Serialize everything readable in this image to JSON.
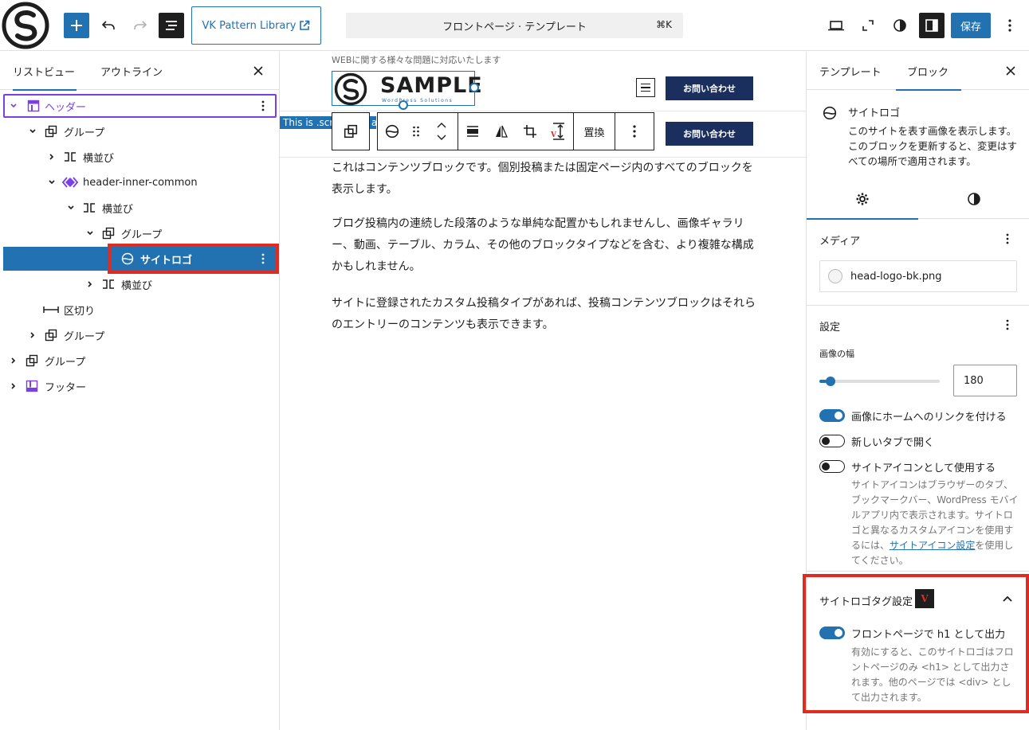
{
  "topbar": {
    "vk_pattern_label": "VK Pattern Library",
    "command_title": "フロントページ · テンプレート",
    "command_shortcut": "⌘K",
    "save_label": "保存"
  },
  "left_panel": {
    "tabs": [
      "リストビュー",
      "アウトライン"
    ],
    "tree": [
      {
        "label": "ヘッダー"
      },
      {
        "label": "グループ"
      },
      {
        "label": "横並び"
      },
      {
        "label": "header-inner-common"
      },
      {
        "label": "横並び"
      },
      {
        "label": "グループ"
      },
      {
        "label": "サイトロゴ"
      },
      {
        "label": "横並び"
      },
      {
        "label": "区切り"
      },
      {
        "label": "グループ"
      },
      {
        "label": "グループ"
      },
      {
        "label": "フッター"
      }
    ]
  },
  "canvas": {
    "tagline": "WEBに関する様々な問題に対応いたします",
    "logo_text": "SAMPLE",
    "logo_sub": "WordPress Solutions",
    "contact_label": "お問い合わせ",
    "screen_reader_text": "This is .scr",
    "screen_reader_tail": "a",
    "replace_label": "置換",
    "paragraphs": [
      "これはコンテンツブロックです。個別投稿または固定ページ内のすべてのブロックを表示します。",
      "ブログ投稿内の連続した段落のような単純な配置かもしれませんし、画像ギャラリー、動画、テーブル、カラム、その他のブロックタイプなどを含む、より複雑な構成かもしれません。",
      "サイトに登録されたカスタム投稿タイプがあれば、投稿コンテンツブロックはそれらのエントリーのコンテンツも表示できます。"
    ]
  },
  "right_panel": {
    "tabs": [
      "テンプレート",
      "ブロック"
    ],
    "block_title": "サイトロゴ",
    "block_desc": "このサイトを表す画像を表示します。このブロックを更新すると、変更はすべての場所で適用されます。",
    "media": {
      "title": "メディア",
      "file": "head-logo-bk.png"
    },
    "settings": {
      "title": "設定",
      "width_label": "画像の幅",
      "width_value": "180",
      "width_fraction": 0.06,
      "link_home_label": "画像にホームへのリンクを付ける",
      "link_home_on": true,
      "new_tab_label": "新しいタブで開く",
      "new_tab_on": false,
      "site_icon_label": "サイトアイコンとして使用する",
      "site_icon_on": false,
      "site_icon_help_pre": "サイトアイコンはブラウザーのタブ、ブックマークバー、WordPress モバイルアプリ内で表示されます。サイトロゴと異なるカスタムアイコンを使用するには、",
      "site_icon_help_link": "サイトアイコン設定",
      "site_icon_help_post": "を使用してください。"
    },
    "logo_tag": {
      "title": "サイトロゴタグ設定",
      "h1_label": "フロントページで h1 として出力",
      "h1_on": true,
      "help": "有効にすると、このサイトロゴはフロントページのみ <h1> として出力されます。他のページでは <div> として出力されます。"
    }
  },
  "colors": {
    "accent": "#2271b1",
    "header_purple": "#7b3fe4",
    "highlight_red": "#e22b20",
    "button_navy": "#1b2f5e"
  }
}
